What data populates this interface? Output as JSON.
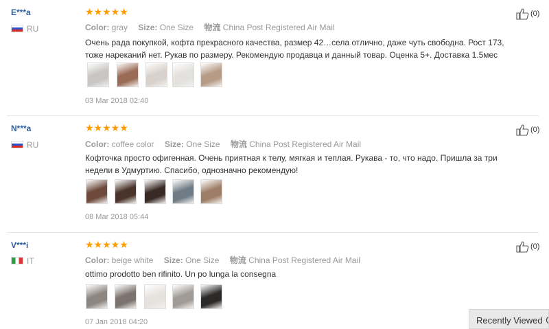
{
  "reviews": [
    {
      "user": "E***a",
      "country": "RU",
      "flag": "ru",
      "stars": "★★★★★",
      "color_label": "Color:",
      "color_value": "gray",
      "size_label": "Size:",
      "size_value": "One Size",
      "shipping_label": "物流",
      "shipping_value": "China Post Registered Air Mail",
      "text": "Очень рада покупкой, кофта прекрасного качества, размер 42…села отлично, даже чуть свободна. Рост 173, тоже нареканий нет. Рукав по размеру. Рекомендую продавца и данный товар. Оценка 5+. Доставка 1.5мес",
      "thumbs": [
        "#c8c6c4",
        "#9a6b55",
        "#d9d2cc",
        "#e3e1de",
        "#b69b87"
      ],
      "date": "03 Mar 2018 02:40",
      "likes": "(0)"
    },
    {
      "user": "N***a",
      "country": "RU",
      "flag": "ru",
      "stars": "★★★★★",
      "color_label": "Color:",
      "color_value": "coffee color",
      "size_label": "Size:",
      "size_value": "One Size",
      "shipping_label": "物流",
      "shipping_value": "China Post Registered Air Mail",
      "text": "Кофточка просто офигенная. Очень приятная к телу, мягкая и теплая. Рукава - то, что надо. Пришла за три недели в Удмуртию. Спасибо, однозначно рекомендую!",
      "thumbs": [
        "#6d4a3c",
        "#4a332b",
        "#3a2a25",
        "#6f7c86",
        "#9d7d66"
      ],
      "date": "08 Mar 2018 05:44",
      "likes": "(0)"
    },
    {
      "user": "V***i",
      "country": "IT",
      "flag": "it",
      "stars": "★★★★★",
      "color_label": "Color:",
      "color_value": "beige white",
      "size_label": "Size:",
      "size_value": "One Size",
      "shipping_label": "物流",
      "shipping_value": "China Post Registered Air Mail",
      "text": "ottimo prodotto ben rifinito. Un po lunga la consegna",
      "thumbs": [
        "#8d8580",
        "#7c736e",
        "#e6e3df",
        "#a09b97",
        "#2c2a29"
      ],
      "date": "07 Jan 2018 04:20",
      "likes": "(0)"
    }
  ],
  "recently_viewed": "Recently Viewed"
}
